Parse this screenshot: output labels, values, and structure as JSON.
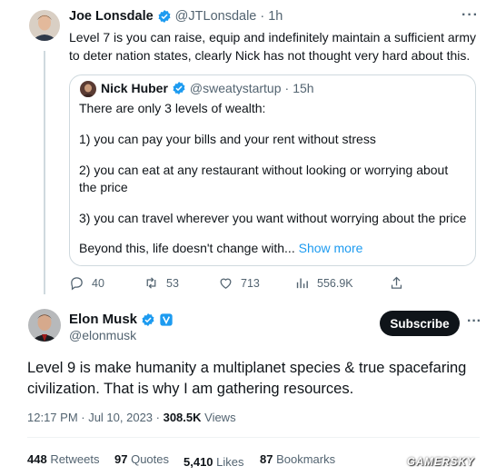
{
  "tweet1": {
    "name": "Joe Lonsdale",
    "handle": "@JTLonsdale",
    "separator": "·",
    "time": "1h",
    "more": "···",
    "text": "Level 7 is you can raise, equip and indefinitely maintain a sufficient army to deter nation states, clearly Nick has not thought very hard about this."
  },
  "quote": {
    "name": "Nick Huber",
    "handle": "@sweatystartup",
    "separator": "·",
    "time": "15h",
    "lines": [
      "There are only 3 levels of wealth:",
      "1) you can pay your bills and your rent without stress",
      "2) you can eat at any restaurant without looking or worrying about the price",
      "3) you can travel wherever you want without worrying about the price",
      "Beyond this, life doesn't change with..."
    ],
    "show_more": "Show more"
  },
  "tweet1_actions": {
    "replies": "40",
    "retweets": "53",
    "likes": "713",
    "views": "556.9K"
  },
  "tweet2": {
    "name": "Elon Musk",
    "handle": "@elonmusk",
    "subscribe_label": "Subscribe",
    "more": "···",
    "text": "Level 9 is make humanity a multiplanet species & true spacefaring civilization. That is why I am gathering resources.",
    "meta_time": "12:17 PM · Jul 10, 2023 · ",
    "meta_views_count": "308.5K",
    "meta_views_label": " Views"
  },
  "stats": {
    "retweets_count": "448",
    "retweets_label": " Retweets",
    "quotes_count": "97",
    "quotes_label": " Quotes",
    "likes_count": "5,410",
    "likes_label": " Likes",
    "bookmarks_count": "87",
    "bookmarks_label": " Bookmarks"
  },
  "watermark": "GAMERSKY",
  "colors": {
    "verified": "#1d9bf0",
    "link": "#1d9bf0",
    "subscribe_bg": "#0f1419",
    "muted": "#536471"
  }
}
